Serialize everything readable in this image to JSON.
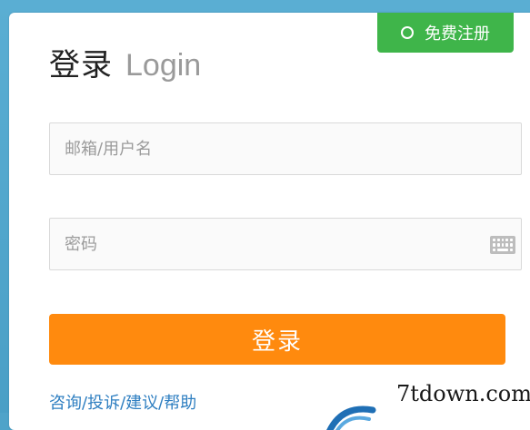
{
  "login": {
    "title_zh": "登录",
    "title_en": "Login",
    "register_label": "免费注册",
    "email_placeholder": "邮箱/用户名",
    "password_placeholder": "密码",
    "submit_label": "登录",
    "help_link": "咨询/投诉/建议/帮助"
  },
  "watermark": {
    "text": "7tdown.com"
  },
  "icons": {
    "register": "ring-icon",
    "password_field": "keyboard-icon",
    "logo": "logo-arc-icon"
  },
  "colors": {
    "background": "#4fa3c9",
    "register_green": "#3fb54a",
    "submit_orange": "#ff8a0e",
    "link_blue": "#2f7fc1",
    "title_dark": "#222222",
    "title_gray": "#9a9a9a"
  }
}
